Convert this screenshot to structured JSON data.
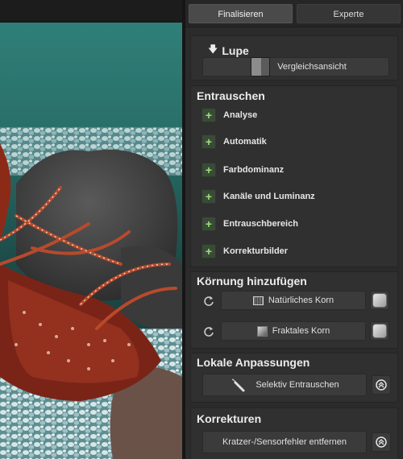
{
  "tabs": [
    {
      "label": "Finalisieren",
      "active": true
    },
    {
      "label": "Experte",
      "active": false
    }
  ],
  "lupe": {
    "title": "Lupe",
    "compare_label": "Vergleichsansicht"
  },
  "entrauschen": {
    "title": "Entrauschen",
    "items": [
      {
        "label": "Analyse"
      },
      {
        "label": "Automatik"
      },
      {
        "label": "Farbdominanz"
      },
      {
        "label": "Kanäle und Luminanz"
      },
      {
        "label": "Entrauschbereich"
      },
      {
        "label": "Korrekturbilder"
      }
    ]
  },
  "koernung": {
    "title": "Körnung hinzufügen",
    "natural_label": "Natürliches Korn",
    "fractal_label": "Fraktales Korn"
  },
  "lokale": {
    "title": "Lokale Anpassungen",
    "selective_label": "Selektiv Entrauschen"
  },
  "korrekturen": {
    "title": "Korrekturen",
    "scratch_label": "Kratzer-/Sensorfehler entfernen"
  },
  "colors": {
    "panel_bg": "#2b2b2b",
    "plus_green": "#9be07a"
  },
  "icons": [
    "down-arrow-icon",
    "plus-icon",
    "refresh-icon",
    "grain-natural-icon",
    "grain-fractal-icon",
    "dice-icon",
    "brush-icon",
    "target-icon"
  ]
}
